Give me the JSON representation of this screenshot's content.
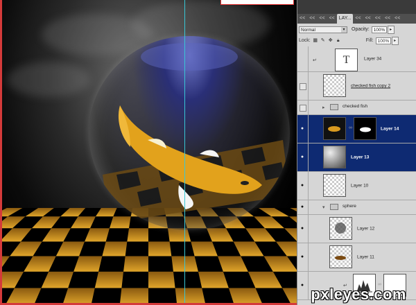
{
  "panel": {
    "tabs": [
      "<<",
      "<<",
      "<<",
      "<<",
      "LAY...",
      "<<",
      "<<",
      "<<",
      "<<",
      "<<"
    ],
    "blend_mode": "Normal",
    "opacity_label": "Opacity:",
    "opacity_value": "100%",
    "lock_label": "Lock:",
    "fill_label": "Fill:",
    "fill_value": "100%"
  },
  "layers": [
    {
      "name": "Layer 34",
      "thumb": "text",
      "visible": false,
      "selected": false
    },
    {
      "name": "checked fish copy 2",
      "thumb": "transparent",
      "visible": false,
      "selected": false
    },
    {
      "name": "checked fish",
      "type": "group",
      "visible": false,
      "selected": false
    },
    {
      "name": "Layer 14",
      "thumb": "fish",
      "mask": "fish-mask",
      "visible": true,
      "selected": true
    },
    {
      "name": "Layer 13",
      "thumb": "gradient",
      "visible": true,
      "selected": true
    },
    {
      "name": "Layer 10",
      "thumb": "transparent",
      "visible": true,
      "selected": false
    },
    {
      "name": "sphere",
      "type": "group",
      "visible": true,
      "selected": false
    },
    {
      "name": "Layer 12",
      "thumb": "dot",
      "visible": true,
      "selected": false
    },
    {
      "name": "Layer 11",
      "thumb": "fish-small",
      "visible": true,
      "selected": false
    },
    {
      "name": "",
      "thumb": "adjustment",
      "mask": "white",
      "visible": true,
      "selected": false
    }
  ],
  "watermark": "pxleyes.com",
  "colors": {
    "selection": "#0e2a72",
    "guide": "#38c7d6",
    "frame": "#d43a3a"
  }
}
